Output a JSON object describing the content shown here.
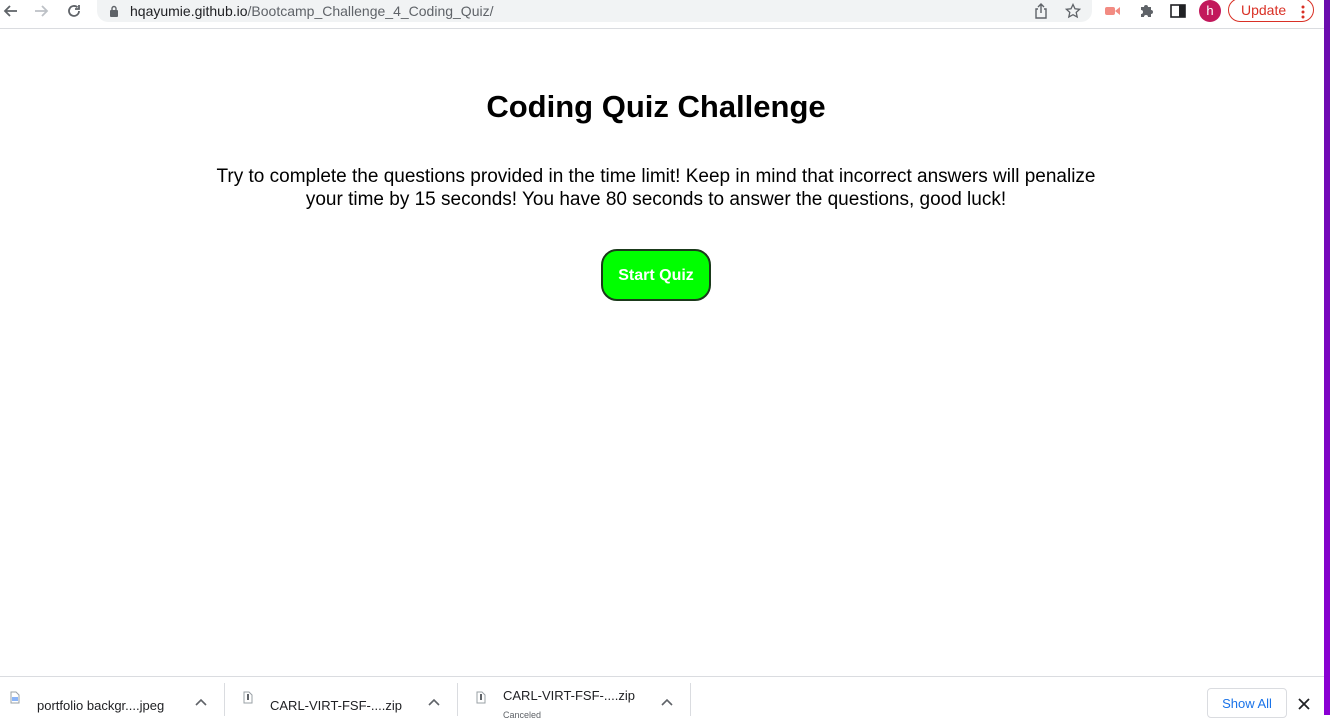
{
  "browser": {
    "url_host": "hqayumie.github.io",
    "url_path": "/Bootcamp_Challenge_4_Coding_Quiz/",
    "avatar_letter": "h",
    "update_label": "Update"
  },
  "page": {
    "title": "Coding Quiz Challenge",
    "description": "Try to complete the questions provided in the time limit! Keep in mind that incorrect answers will penalize your time by 15 seconds! You have 80 seconds to answer the questions, good luck!",
    "start_button": "Start Quiz"
  },
  "downloads": {
    "items": [
      {
        "name": "portfolio backgr....jpeg",
        "status": ""
      },
      {
        "name": "CARL-VIRT-FSF-....zip",
        "status": ""
      },
      {
        "name": "CARL-VIRT-FSF-....zip",
        "status": "Canceled"
      }
    ],
    "show_all": "Show All"
  },
  "colors": {
    "start_button_bg": "#00ff00",
    "update_accent": "#d93025",
    "avatar_bg": "#c2185b",
    "link_blue": "#1a73e8"
  }
}
